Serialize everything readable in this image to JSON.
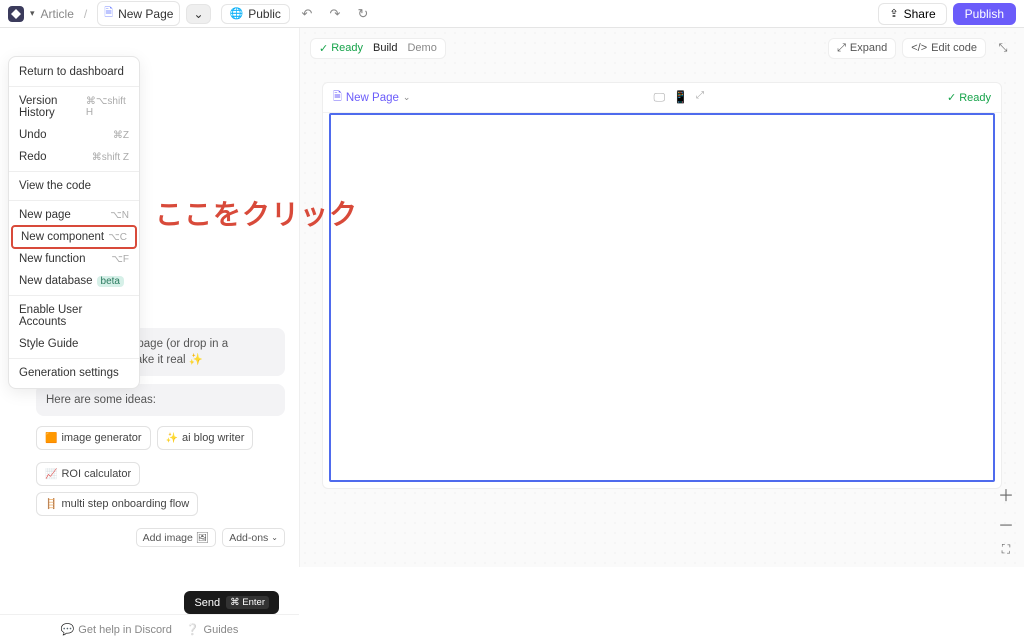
{
  "toolbar": {
    "breadcrumb_article": "Article",
    "page_name": "New Page",
    "public_label": "Public",
    "share_label": "Share",
    "publish_label": "Publish"
  },
  "dropdown": {
    "return": "Return to dashboard",
    "version_history": "Version History",
    "version_history_sc": "⌘⌥shift H",
    "undo": "Undo",
    "undo_sc": "⌘Z",
    "redo": "Redo",
    "redo_sc": "⌘shift Z",
    "view_code": "View the code",
    "new_page": "New page",
    "new_page_sc": "⌥N",
    "new_component": "New component",
    "new_component_sc": "⌥C",
    "new_function": "New function",
    "new_function_sc": "⌥F",
    "new_database": "New database",
    "beta": "beta",
    "enable_accounts": "Enable User Accounts",
    "style_guide": "Style Guide",
    "gen_settings": "Generation settings"
  },
  "annotation": "ここをクリック",
  "chat": {
    "greeting": "Hi! Describe your page (or drop in a screenshot). I'll make it real ✨",
    "ideas_intro": "Here are some ideas:",
    "idea1": "image generator",
    "idea2": "ai blog writer",
    "idea3": "ROI calculator",
    "idea4": "multi step onboarding flow",
    "add_image": "Add image",
    "addons": "Add-ons",
    "send": "Send",
    "send_sc": "⌘ Enter"
  },
  "footer": {
    "discord": "Get help in Discord",
    "guides": "Guides"
  },
  "canvas": {
    "ready": "Ready",
    "build": "Build",
    "demo": "Demo",
    "expand": "Expand",
    "edit_code": "Edit code",
    "page_title": "New Page",
    "inner_ready": "Ready"
  }
}
